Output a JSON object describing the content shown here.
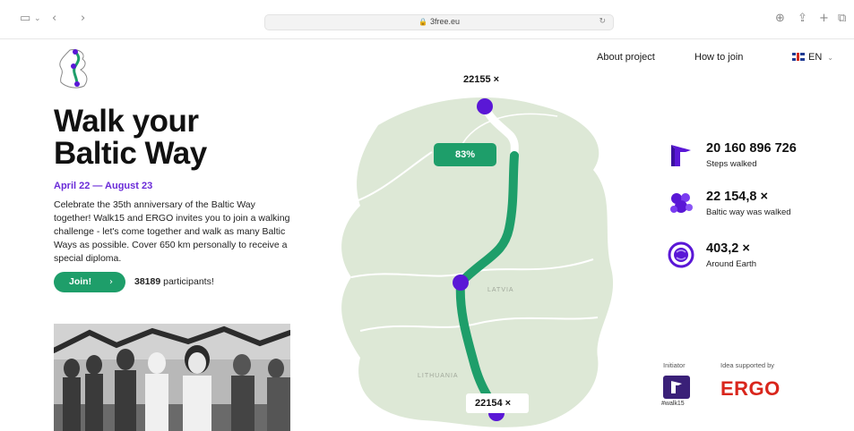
{
  "browser": {
    "url": "3free.eu",
    "icons": [
      "sidebar-icon",
      "chevron-down-icon",
      "back-icon",
      "forward-icon",
      "lock-icon",
      "translate-icon",
      "reload-icon",
      "download-icon",
      "share-icon",
      "new-tab-icon",
      "tabs-icon"
    ]
  },
  "nav": {
    "about": "About project",
    "how": "How to join",
    "lang": "EN"
  },
  "hero": {
    "line1": "Walk your",
    "line2": "Baltic Way",
    "dates": "April 22 — August 23",
    "description": "Celebrate the 35th anniversary of the Baltic Way together! Walk15 and ERGO invites you to join a walking challenge - let's come together and walk as many Baltic Ways as possible. Cover 650 km personally to receive a special diploma.",
    "join_label": "Join!",
    "join_arrow": "›",
    "participants_count": "38189",
    "participants_label": "participants!"
  },
  "map": {
    "top_count": "22155 ×",
    "bottom_count": "22154 ×",
    "progress_label": "83%",
    "progress": 0.83,
    "country_latvia": "LATVIA",
    "country_lithuania": "LITHUANIA",
    "colors": {
      "route": "#1e9e6a",
      "dot": "#5a17d6",
      "land": "#dde8d6"
    }
  },
  "stats": [
    {
      "value": "20 160 896 726",
      "label": "Steps walked",
      "icon": "steps-flag-icon"
    },
    {
      "value": "22 154,8 ×",
      "label": "Baltic way was walked",
      "icon": "people-cluster-icon"
    },
    {
      "value": "403,2 ×",
      "label": "Around Earth",
      "icon": "globe-cycle-icon"
    }
  ],
  "partners": {
    "initiator_label": "Initiator",
    "supported_label": "Idea supported by",
    "walk15": "#walk15",
    "ergo": "ERGO"
  }
}
